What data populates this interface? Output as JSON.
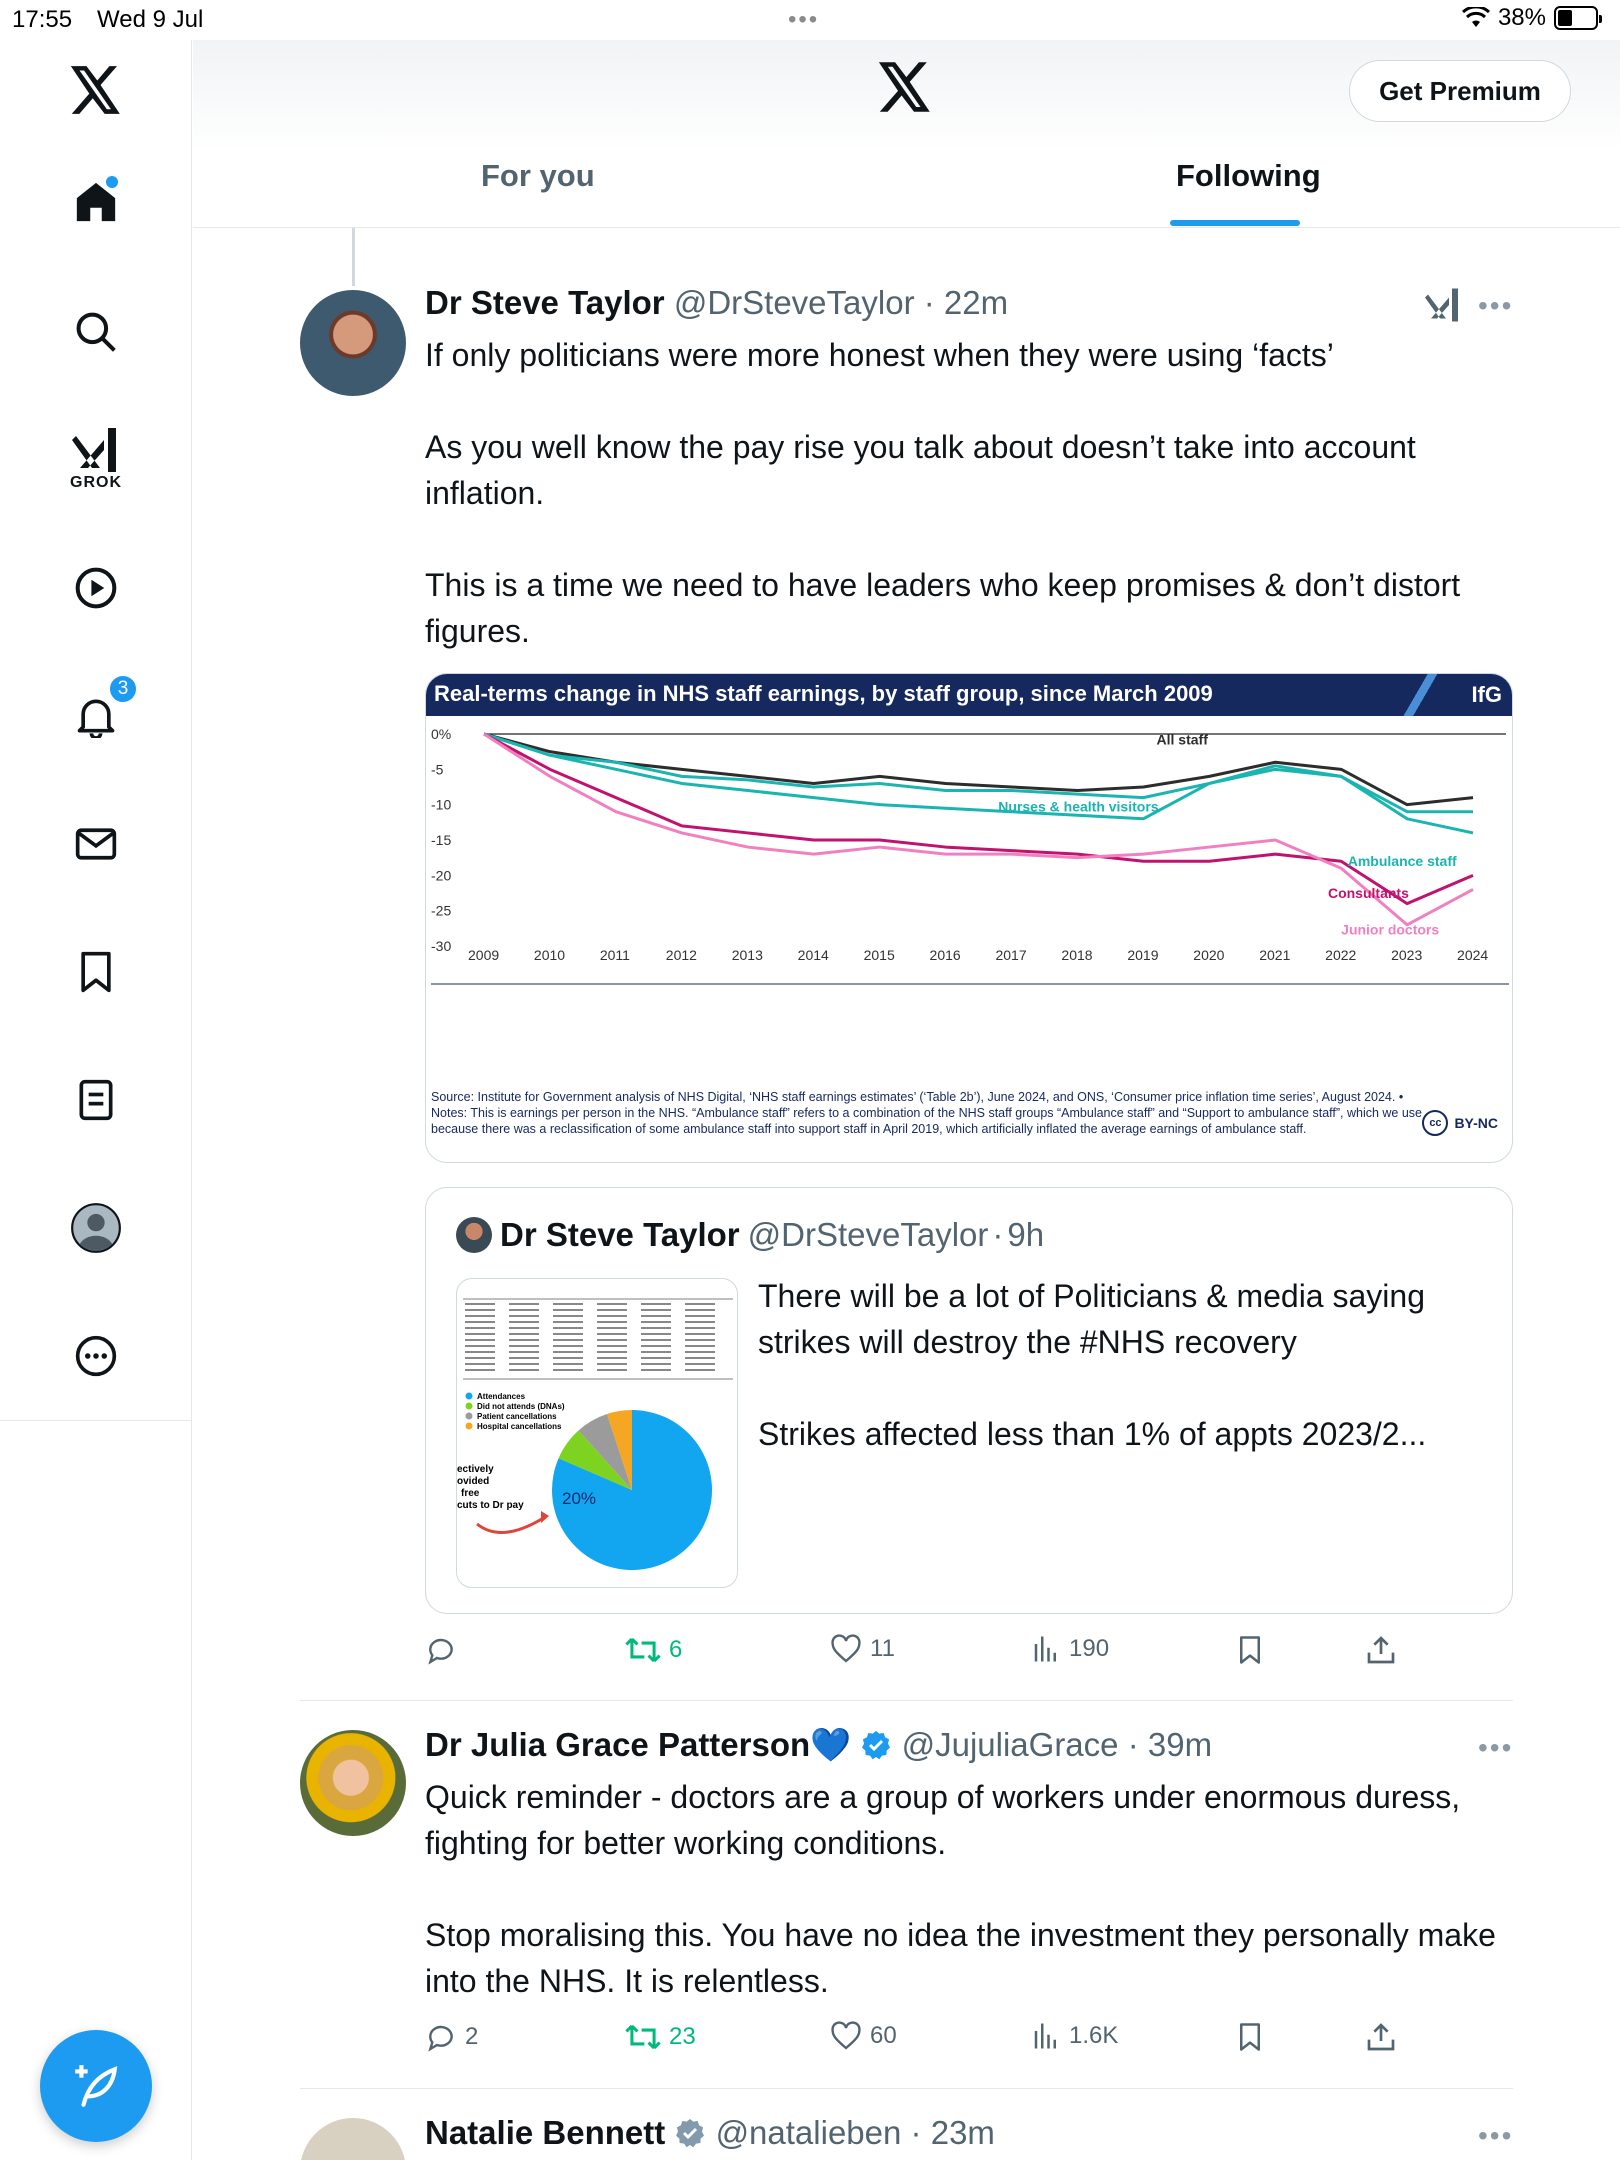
{
  "status_bar": {
    "time": "17:55",
    "date": "Wed 9 Jul",
    "battery": "38%"
  },
  "sidebar": {
    "items": [
      {
        "name": "home",
        "label": ""
      },
      {
        "name": "search",
        "label": ""
      },
      {
        "name": "grok",
        "label": "GROK"
      },
      {
        "name": "video",
        "label": ""
      },
      {
        "name": "notifications",
        "label": "",
        "badge": "3"
      },
      {
        "name": "messages",
        "label": ""
      },
      {
        "name": "bookmarks",
        "label": ""
      },
      {
        "name": "lists",
        "label": ""
      },
      {
        "name": "profile",
        "label": ""
      },
      {
        "name": "more",
        "label": ""
      }
    ]
  },
  "header": {
    "premium_label": "Get Premium",
    "tabs": [
      {
        "label": "For you",
        "active": false
      },
      {
        "label": "Following",
        "active": true
      }
    ]
  },
  "tweets": [
    {
      "name": "Dr Steve Taylor",
      "handle": "@DrSteveTaylor",
      "time": "22m",
      "paragraphs": [
        "If only politicians were more honest when they were using ‘facts’",
        "As you well know the pay rise you talk about doesn’t take into account inflation.",
        "This is a time we need to have leaders who keep promises & don’t distort figures."
      ],
      "image": {
        "title": "Real-terms change in NHS staff earnings, by staff group, since March 2009",
        "brand": "IfG",
        "source": "Source: Institute for Government analysis of NHS Digital, ‘NHS staff earnings estimates’ (‘Table 2b’), June 2024, and ONS, ‘Consumer price inflation time series’, August 2024. • Notes: This is earnings per person in the NHS. “Ambulance staff” refers to a combination of the NHS staff groups “Ambulance staff” and “Support to ambulance staff”, which we use because there was a reclassification of some ambulance staff into support staff in April 2019, which artificially inflated the average earnings of ambulance staff.",
        "license": "BY-NC",
        "license_badge": "cc"
      },
      "quote": {
        "name": "Dr Steve Taylor",
        "handle": "@DrSteveTaylor",
        "time": "9h",
        "paragraphs": [
          "There will be a lot of Politicians & media saying strikes will destroy the #NHS recovery",
          "Strikes affected less than 1% of appts 2023/2..."
        ],
        "image": {
          "legend": [
            "Attendances",
            "Did not attends (DNAs)",
            "Patient cancellations",
            "Hospital cancellations"
          ],
          "side_text": [
            "ectively",
            "ovided",
            "free",
            "cuts to Dr pay"
          ],
          "pie_label": "20%",
          "pie_colors": [
            "#12a5f0",
            "#7ed321",
            "#9b9b9b",
            "#f5a623"
          ]
        }
      },
      "actions": {
        "replies": "",
        "retweets": "6",
        "likes": "11",
        "views": "190"
      }
    },
    {
      "name": "Dr Julia Grace Patterson",
      "emoji": "💙",
      "handle": "@JujuliaGrace",
      "time": "39m",
      "verified": true,
      "paragraphs": [
        "Quick reminder - doctors are a group of workers under enormous duress, fighting for better working conditions.",
        "Stop moralising this. You have no idea the investment they personally make into the NHS. It is relentless."
      ],
      "actions": {
        "replies": "2",
        "retweets": "23",
        "likes": "60",
        "views": "1.6K"
      }
    },
    {
      "name": "Natalie Bennett",
      "handle": "@natalieben",
      "time": "23m",
      "verified": true
    }
  ],
  "chart_data": {
    "type": "line",
    "title": "Real-terms change in NHS staff earnings, by staff group, since March 2009",
    "xlabel": "",
    "ylabel": "",
    "x": [
      2009,
      2010,
      2011,
      2012,
      2013,
      2014,
      2015,
      2016,
      2017,
      2018,
      2019,
      2020,
      2021,
      2022,
      2023,
      2024
    ],
    "y_ticks": [
      "0%",
      "-5",
      "-10",
      "-15",
      "-20",
      "-25",
      "-30"
    ],
    "ylim": [
      -30,
      0
    ],
    "series": [
      {
        "name": "All staff",
        "color": "#2d2d2d",
        "values": [
          0,
          -2.5,
          -4,
          -5,
          -6,
          -7,
          -6,
          -7,
          -7.5,
          -8,
          -7.5,
          -6,
          -4,
          -5,
          -10,
          -9
        ]
      },
      {
        "name": "Nurses & health visitors",
        "color": "#1ab5b0",
        "values": [
          0,
          -3,
          -5,
          -7,
          -8,
          -9,
          -10,
          -10.5,
          -11,
          -11.5,
          -12,
          -7,
          -5,
          -6,
          -11,
          -11
        ]
      },
      {
        "name": "Ambulance staff",
        "color": "#1ab5b0",
        "values": [
          0,
          -3,
          -4,
          -6,
          -6.5,
          -7.5,
          -7,
          -8,
          -8,
          -8.5,
          -9,
          -7,
          -4.5,
          -6,
          -12,
          -14
        ]
      },
      {
        "name": "Consultants",
        "color": "#c0126e",
        "values": [
          0,
          -5,
          -9,
          -13,
          -14,
          -15,
          -15,
          -16,
          -16.5,
          -17,
          -18,
          -18,
          -17,
          -18,
          -24,
          -20
        ]
      },
      {
        "name": "Junior doctors",
        "color": "#f080c0",
        "values": [
          0,
          -6,
          -11,
          -14,
          -16,
          -17,
          -16,
          -17,
          -17,
          -17.5,
          -17,
          -16,
          -15,
          -19,
          -27,
          -22
        ]
      }
    ]
  }
}
